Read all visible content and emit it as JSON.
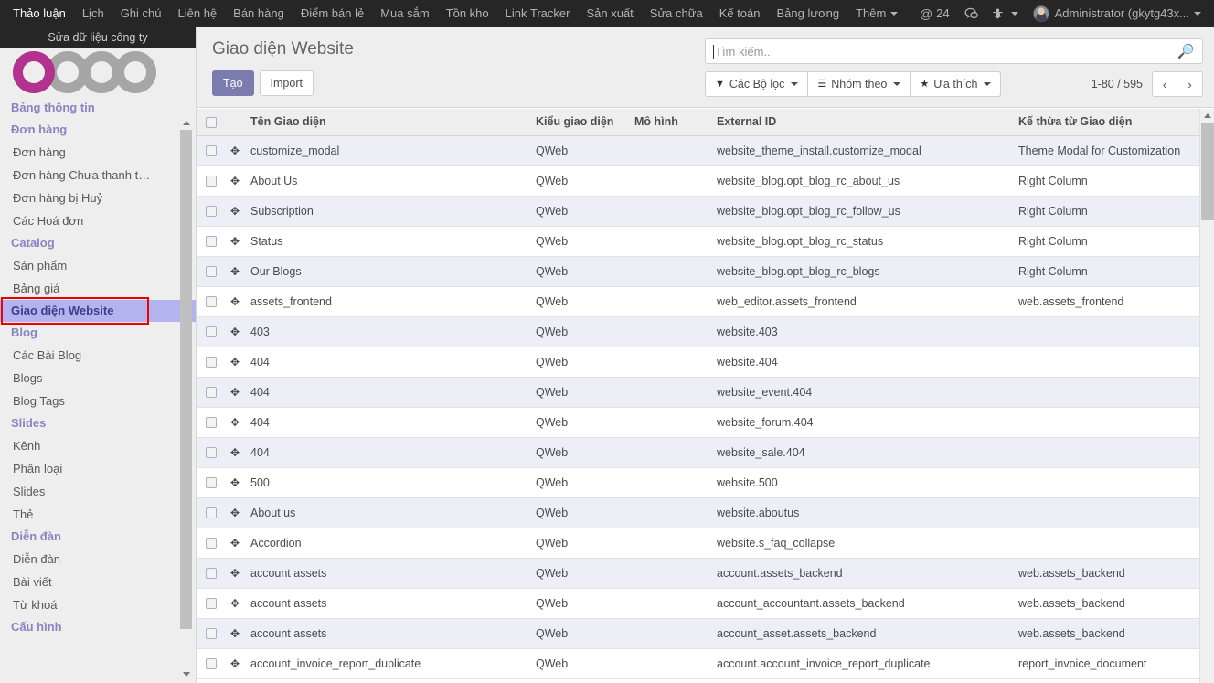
{
  "topbar": {
    "menu_items": [
      "Thảo luận",
      "Lịch",
      "Ghi chú",
      "Liên hệ",
      "Bán hàng",
      "Điểm bán lẻ",
      "Mua sắm",
      "Tồn kho",
      "Link Tracker",
      "Sản xuất",
      "Sửa chữa",
      "Kế toán",
      "Bảng lương"
    ],
    "more_label": "Thêm",
    "mention_icon": "at-sign-icon",
    "mention_count": "24",
    "chat_icon": "chat-bubble-icon",
    "debug_icon": "bug-icon",
    "avatar_icon": "user-avatar",
    "user_label": "Administrator (gkytg43x..."
  },
  "sidebar": {
    "company_label": "Sửa dữ liệu công ty",
    "logo": "odoo-logo",
    "nav": [
      {
        "type": "section",
        "label": "Bảng thông tin",
        "active": false
      },
      {
        "type": "section",
        "label": "Đơn hàng",
        "active": false
      },
      {
        "type": "link",
        "label": "Đơn hàng"
      },
      {
        "type": "link",
        "label": "Đơn hàng Chưa thanh t…"
      },
      {
        "type": "link",
        "label": "Đơn hàng bị Huỷ"
      },
      {
        "type": "link",
        "label": "Các Hoá đơn"
      },
      {
        "type": "section",
        "label": "Catalog",
        "active": false
      },
      {
        "type": "link",
        "label": "Sản phẩm"
      },
      {
        "type": "link",
        "label": "Bảng giá"
      },
      {
        "type": "section",
        "label": "Giao diện Website",
        "active": true
      },
      {
        "type": "section",
        "label": "Blog",
        "active": false
      },
      {
        "type": "link",
        "label": "Các Bài Blog"
      },
      {
        "type": "link",
        "label": "Blogs"
      },
      {
        "type": "link",
        "label": "Blog Tags"
      },
      {
        "type": "section",
        "label": "Slides",
        "active": false
      },
      {
        "type": "link",
        "label": "Kênh"
      },
      {
        "type": "link",
        "label": "Phân loại"
      },
      {
        "type": "link",
        "label": "Slides"
      },
      {
        "type": "link",
        "label": "Thẻ"
      },
      {
        "type": "section",
        "label": "Diễn đàn",
        "active": false
      },
      {
        "type": "link",
        "label": "Diễn đàn"
      },
      {
        "type": "link",
        "label": "Bài viết"
      },
      {
        "type": "link",
        "label": "Từ khoá"
      },
      {
        "type": "section",
        "label": "Cấu hình",
        "active": false
      }
    ],
    "highlight_color": "#ee0000",
    "active_bg": "#b3b3ee"
  },
  "control_panel": {
    "title": "Giao diện Website",
    "create_label": "Tạo",
    "import_label": "Import",
    "primary_color": "#7c7bad"
  },
  "search": {
    "placeholder": "Tìm kiếm...",
    "value": "",
    "search_icon": "search-icon"
  },
  "filters": {
    "filters_label": "Các Bộ lọc",
    "filters_icon": "funnel-icon",
    "groupby_label": "Nhóm theo",
    "groupby_icon": "hamburger-icon",
    "favorites_label": "Ưa thích",
    "favorites_icon": "star-icon"
  },
  "pager": {
    "range_label": "1-80 / 595",
    "prev_icon": "chevron-left-icon",
    "prev_glyph": "‹",
    "next_icon": "chevron-right-icon",
    "next_glyph": "›"
  },
  "table": {
    "columns": [
      "Tên Giao diện",
      "Kiểu giao diện",
      "Mô hình",
      "External ID",
      "Kế thừa từ Giao diện"
    ],
    "handle_icon": "drag-move-icon",
    "handle_glyph": "✥",
    "rows": [
      {
        "name": "customize_modal",
        "type": "QWeb",
        "model": "",
        "ext": "website_theme_install.customize_modal",
        "inherit": "Theme Modal for Customization"
      },
      {
        "name": "About Us",
        "type": "QWeb",
        "model": "",
        "ext": "website_blog.opt_blog_rc_about_us",
        "inherit": "Right Column"
      },
      {
        "name": "Subscription",
        "type": "QWeb",
        "model": "",
        "ext": "website_blog.opt_blog_rc_follow_us",
        "inherit": "Right Column"
      },
      {
        "name": "Status",
        "type": "QWeb",
        "model": "",
        "ext": "website_blog.opt_blog_rc_status",
        "inherit": "Right Column"
      },
      {
        "name": "Our Blogs",
        "type": "QWeb",
        "model": "",
        "ext": "website_blog.opt_blog_rc_blogs",
        "inherit": "Right Column"
      },
      {
        "name": "assets_frontend",
        "type": "QWeb",
        "model": "",
        "ext": "web_editor.assets_frontend",
        "inherit": "web.assets_frontend"
      },
      {
        "name": "403",
        "type": "QWeb",
        "model": "",
        "ext": "website.403",
        "inherit": ""
      },
      {
        "name": "404",
        "type": "QWeb",
        "model": "",
        "ext": "website.404",
        "inherit": ""
      },
      {
        "name": "404",
        "type": "QWeb",
        "model": "",
        "ext": "website_event.404",
        "inherit": ""
      },
      {
        "name": "404",
        "type": "QWeb",
        "model": "",
        "ext": "website_forum.404",
        "inherit": ""
      },
      {
        "name": "404",
        "type": "QWeb",
        "model": "",
        "ext": "website_sale.404",
        "inherit": ""
      },
      {
        "name": "500",
        "type": "QWeb",
        "model": "",
        "ext": "website.500",
        "inherit": ""
      },
      {
        "name": "About us",
        "type": "QWeb",
        "model": "",
        "ext": "website.aboutus",
        "inherit": ""
      },
      {
        "name": "Accordion",
        "type": "QWeb",
        "model": "",
        "ext": "website.s_faq_collapse",
        "inherit": ""
      },
      {
        "name": "account assets",
        "type": "QWeb",
        "model": "",
        "ext": "account.assets_backend",
        "inherit": "web.assets_backend"
      },
      {
        "name": "account assets",
        "type": "QWeb",
        "model": "",
        "ext": "account_accountant.assets_backend",
        "inherit": "web.assets_backend"
      },
      {
        "name": "account assets",
        "type": "QWeb",
        "model": "",
        "ext": "account_asset.assets_backend",
        "inherit": "web.assets_backend"
      },
      {
        "name": "account_invoice_report_duplicate",
        "type": "QWeb",
        "model": "",
        "ext": "account.account_invoice_report_duplicate",
        "inherit": "report_invoice_document"
      }
    ]
  }
}
